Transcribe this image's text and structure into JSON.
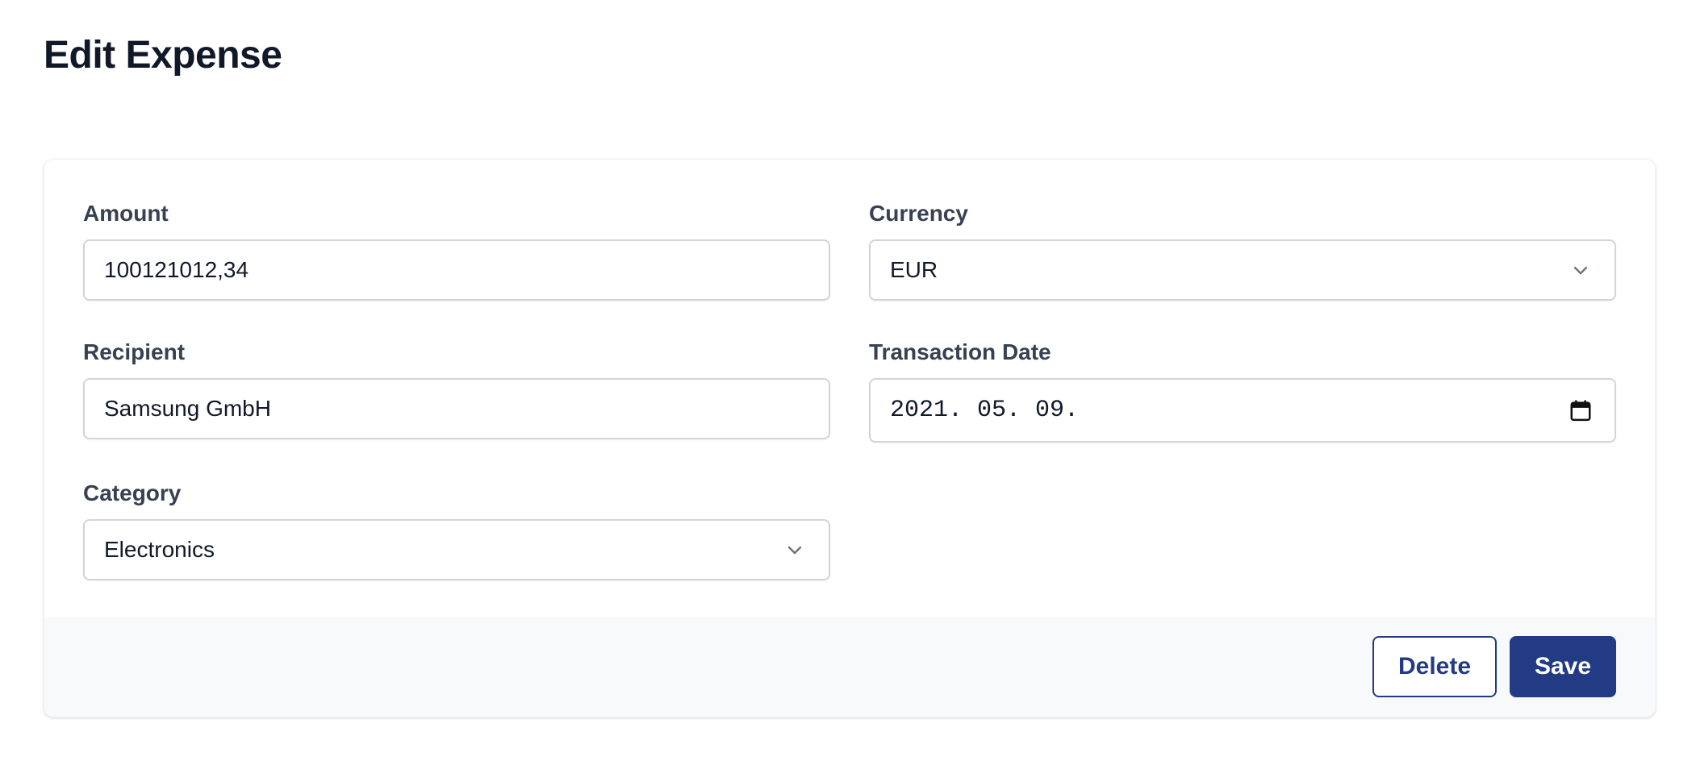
{
  "page": {
    "title": "Edit Expense"
  },
  "form": {
    "amount": {
      "label": "Amount",
      "value": "100121012,34"
    },
    "currency": {
      "label": "Currency",
      "value": "EUR"
    },
    "recipient": {
      "label": "Recipient",
      "value": "Samsung GmbH"
    },
    "transaction_date": {
      "label": "Transaction Date",
      "value": "2021. 05. 09."
    },
    "category": {
      "label": "Category",
      "value": "Electronics"
    }
  },
  "actions": {
    "delete_label": "Delete",
    "save_label": "Save"
  },
  "icons": {
    "select_chevron": "chevron-down-icon",
    "date_picker": "calendar-icon"
  },
  "colors": {
    "primary": "#233b85",
    "title_text": "#111827",
    "label_text": "#374151",
    "input_border": "#d1d5db",
    "footer_bg": "#f8f9fb"
  }
}
